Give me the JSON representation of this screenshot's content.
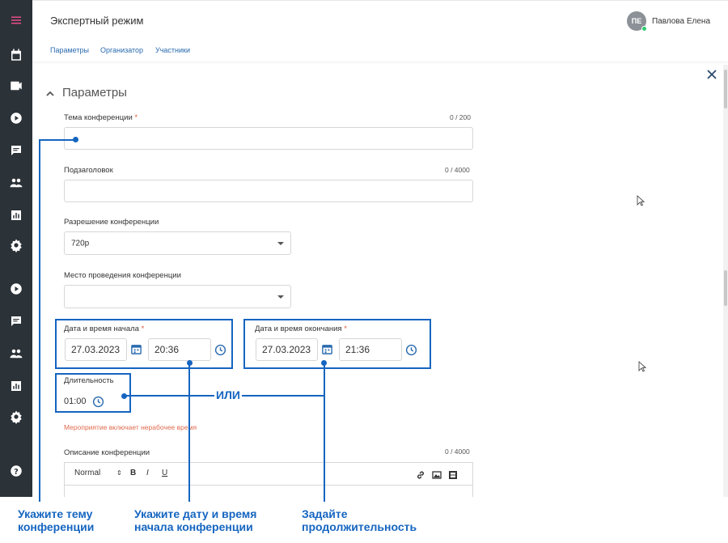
{
  "header": {
    "title": "Экспертный режим",
    "tabs": [
      "Параметры",
      "Организатор",
      "Участники"
    ],
    "user": {
      "initials": "ПЕ",
      "name": "Павлова Елена",
      "status_color": "#2ecc71"
    }
  },
  "sidebar": {
    "icons": [
      "menu-icon",
      "calendar-icon",
      "video-camera-icon",
      "play-icon",
      "chat-icon",
      "users-icon",
      "chart-icon",
      "settings-icon",
      "play-icon",
      "chat-icon",
      "users-icon",
      "chart-icon",
      "settings-icon",
      "help-icon"
    ]
  },
  "section": {
    "title": "Параметры"
  },
  "form": {
    "topic": {
      "label": "Тема конференции",
      "required": "*",
      "counter": "0 / 200",
      "value": ""
    },
    "subtitle": {
      "label": "Подзаголовок",
      "counter": "0 / 4000",
      "value": ""
    },
    "resolution": {
      "label": "Разрешение конференции",
      "value": "720p"
    },
    "location": {
      "label": "Место проведения конференции",
      "value": ""
    },
    "start": {
      "label": "Дата и время начала",
      "required": "*",
      "date": "27.03.2023",
      "time": "20:36"
    },
    "end": {
      "label": "Дата и время окончания",
      "required": "*",
      "date": "27.03.2023",
      "time": "21:36"
    },
    "duration": {
      "label": "Длительность",
      "value": "01:00"
    },
    "warning": "Мероприятие включает нерабочее время",
    "description": {
      "label": "Описание конференции",
      "counter": "0 / 4000",
      "format": "Normal",
      "bold": "B",
      "italic": "I",
      "underline": "U"
    }
  },
  "annotations": {
    "or": "ИЛИ",
    "topic_hint": [
      "Укажите тему",
      "конференции"
    ],
    "start_hint": [
      "Укажите дату и время",
      "начала конференции"
    ],
    "duration_hint": [
      "Задайте",
      "продолжительность"
    ]
  },
  "colors": {
    "accent": "#1565c0",
    "sidebar": "#2b3238",
    "link": "#2a6bb0",
    "warning": "#e06b4e"
  }
}
